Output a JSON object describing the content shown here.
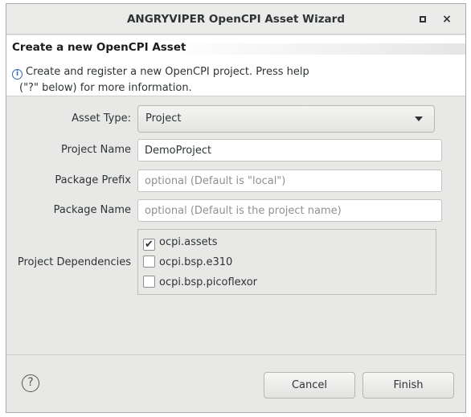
{
  "window": {
    "title": "ANGRYVIPER OpenCPI Asset Wizard"
  },
  "header": {
    "title": "Create a new OpenCPI Asset",
    "info_line1": "Create and register a new OpenCPI project. Press help",
    "info_line2": "(\"?\" below) for more information."
  },
  "form": {
    "asset_type": {
      "label": "Asset Type:",
      "value": "Project"
    },
    "project_name": {
      "label": "Project Name",
      "value": "DemoProject"
    },
    "package_prefix": {
      "label": "Package Prefix",
      "value": "",
      "placeholder": "optional (Default is \"local\")"
    },
    "package_name": {
      "label": "Package Name",
      "value": "",
      "placeholder": "optional (Default is the project name)"
    },
    "dependencies": {
      "label": "Project Dependencies",
      "items": [
        {
          "label": "ocpi.assets",
          "checked": true
        },
        {
          "label": "ocpi.bsp.e310",
          "checked": false
        },
        {
          "label": "ocpi.bsp.picoflexor",
          "checked": false
        }
      ]
    }
  },
  "footer": {
    "help": "?",
    "cancel": "Cancel",
    "finish": "Finish"
  },
  "icons": {
    "maximize": "maximize-icon",
    "close": "close-icon",
    "info": "info-icon",
    "help": "help-icon",
    "check": "✔",
    "close_glyph": "×",
    "info_glyph": "i"
  }
}
